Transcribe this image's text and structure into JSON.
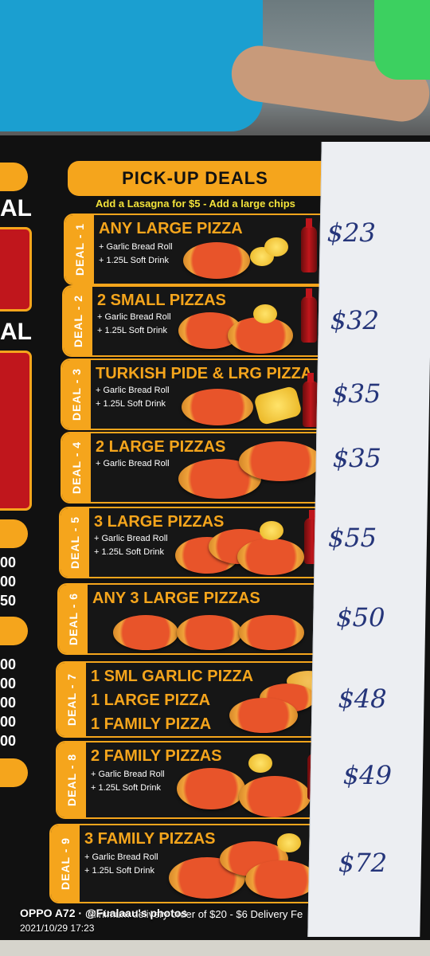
{
  "header": {
    "title": "PICK-UP DEALS",
    "subtitle": "Add a Lasagna for $5 - Add a large chips"
  },
  "left_strip": {
    "letters": [
      "AL",
      "AL"
    ],
    "numbers": [
      "00",
      "00",
      "50",
      "00",
      "00",
      "00",
      "00",
      "00"
    ]
  },
  "deals": [
    {
      "tab": "DEAL - 1",
      "title": "ANY LARGE PIZZA",
      "extras": [
        "+ Garlic Bread Roll",
        "+ 1.25L Soft Drink"
      ],
      "price": "$23"
    },
    {
      "tab": "DEAL - 2",
      "title": "2 SMALL PIZZAS",
      "extras": [
        "+ Garlic Bread Roll",
        "+ 1.25L Soft Drink"
      ],
      "price": "$32"
    },
    {
      "tab": "DEAL - 3",
      "title": "TURKISH PIDE & LRG PIZZA",
      "extras": [
        "+ Garlic Bread Roll",
        "+ 1.25L Soft Drink"
      ],
      "price": "$35"
    },
    {
      "tab": "DEAL - 4",
      "title": "2 LARGE PIZZAS",
      "extras": [
        "+ Garlic Bread Roll"
      ],
      "price": "$35"
    },
    {
      "tab": "DEAL - 5",
      "title": "3 LARGE PIZZAS",
      "extras": [
        "+ Garlic Bread Roll",
        "+ 1.25L Soft Drink"
      ],
      "price": "$55"
    },
    {
      "tab": "DEAL - 6",
      "title": "ANY 3 LARGE PIZZAS",
      "extras": [],
      "price": "$50"
    },
    {
      "tab": "DEAL - 7",
      "title": "1 SML GARLIC PIZZA",
      "title2": "1 LARGE PIZZA",
      "title3": "1 FAMILY PIZZA",
      "extras": [],
      "price": "$48"
    },
    {
      "tab": "DEAL - 8",
      "title": "2 FAMILY PIZZAS",
      "extras": [
        "+ Garlic Bread Roll",
        "+ 1.25L Soft Drink"
      ],
      "price": "$49"
    },
    {
      "tab": "DEAL - 9",
      "title": "3 FAMILY PIZZAS",
      "extras": [
        "+ Garlic Bread Roll",
        "+ 1.25L Soft Drink"
      ],
      "price": "$72"
    }
  ],
  "footer": "Minimum delivery order of $20 - $6 Delivery Fe",
  "watermark": {
    "device": "OPPO A72 · @Fualaau's photos",
    "datetime": "2021/10/29 17:23"
  },
  "colors": {
    "accent": "#f5a51c",
    "price_ink": "#25357a",
    "subtitle": "#f2e23a"
  }
}
